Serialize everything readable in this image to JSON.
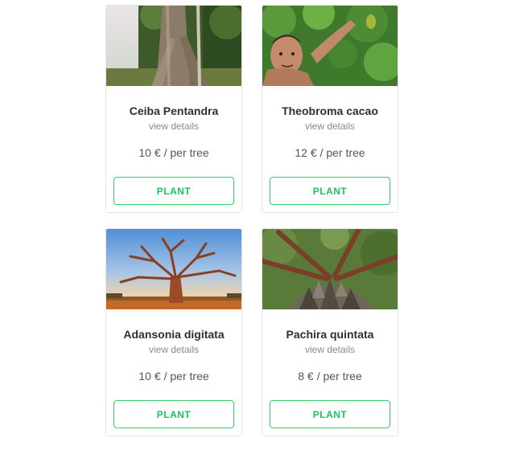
{
  "cards": [
    {
      "name": "Ceiba Pentandra",
      "details_label": "view details",
      "price": "10 €",
      "unit": "/ per tree",
      "button_label": "PLANT",
      "image": "ceiba-trunk-photo"
    },
    {
      "name": "Theobroma cacao",
      "details_label": "view details",
      "price": "12 €",
      "unit": "/ per tree",
      "button_label": "PLANT",
      "image": "man-picking-cacao-photo"
    },
    {
      "name": "Adansonia digitata",
      "details_label": "view details",
      "price": "10 €",
      "unit": "/ per tree",
      "button_label": "PLANT",
      "image": "baobab-sunset-photo"
    },
    {
      "name": "Pachira quintata",
      "details_label": "view details",
      "price": "8 €",
      "unit": "/ per tree",
      "button_label": "PLANT",
      "image": "spiny-trunk-photo"
    }
  ],
  "colors": {
    "accent": "#2fcf6c",
    "title_text": "#2f2f2f",
    "muted_text": "#8a8a8a",
    "card_border": "#e4e4e4"
  }
}
